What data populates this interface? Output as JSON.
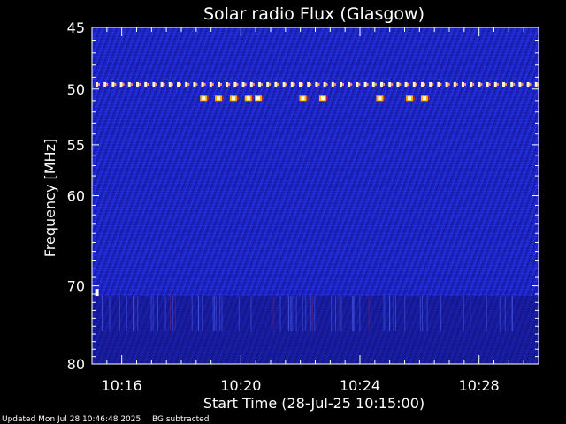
{
  "chart_data": {
    "type": "heatmap",
    "title": "Solar radio Flux (Glasgow)",
    "xlabel": "Start Time (28-Jul-25 10:15:00)",
    "ylabel": "Frequency [MHz]",
    "x_range": [
      "10:15:00",
      "10:30:00"
    ],
    "y_range_mhz": [
      45,
      80
    ],
    "y_scale": "log",
    "y_ticks": [
      45,
      50,
      55,
      60,
      70,
      80
    ],
    "y_tick_labels": [
      "45",
      "50",
      "55",
      "60",
      "70",
      "80"
    ],
    "x_ticks": [
      "10:16",
      "10:20",
      "10:24",
      "10:28"
    ],
    "x_tick_labels": [
      "10:16",
      "10:20",
      "10:24",
      "10:28"
    ],
    "colormap": [
      "#0b0b6e",
      "#1a22c8",
      "#3b52ff",
      "#b03020",
      "#ffaa00",
      "#ffffff"
    ],
    "features": [
      {
        "kind": "interference-line",
        "freq_mhz": 49.6,
        "time_range": [
          "10:15:00",
          "10:30:00"
        ]
      },
      {
        "kind": "burst-row",
        "freq_mhz": 50.8,
        "times": [
          "10:18:45",
          "10:19:15",
          "10:19:45",
          "10:20:15",
          "10:20:35",
          "10:22:05",
          "10:22:45",
          "10:24:40",
          "10:25:40",
          "10:26:10"
        ]
      },
      {
        "kind": "spot",
        "freq_mhz": 70.8,
        "time": "10:15:10"
      }
    ]
  },
  "footer": {
    "updated": "Updated Mon Jul 28 10:46:48 2025",
    "note": "BG subtracted"
  }
}
